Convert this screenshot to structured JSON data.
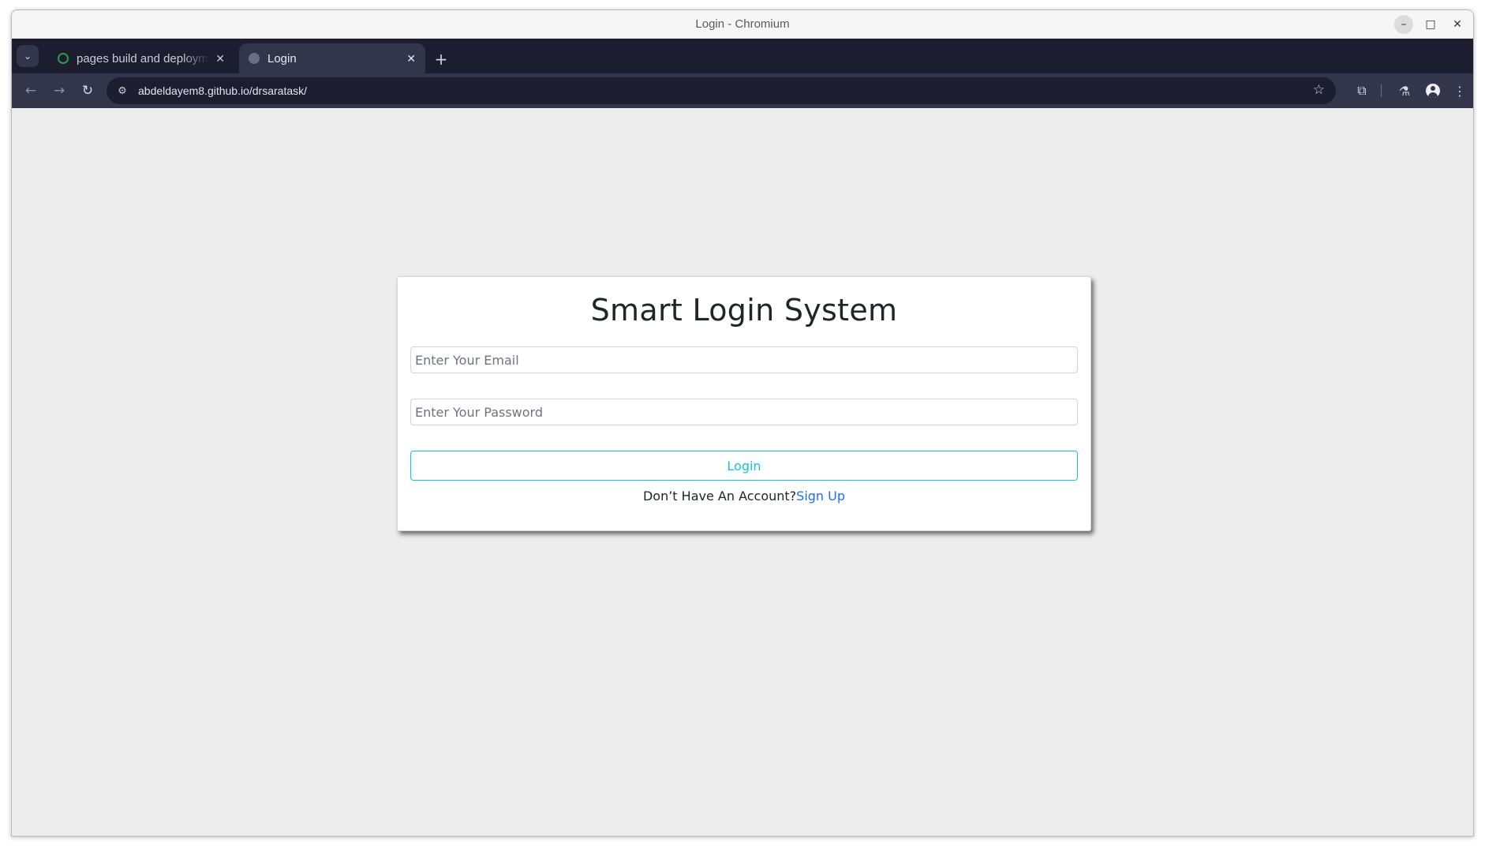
{
  "window": {
    "title": "Login - Chromium",
    "controls": {
      "minimize": "–",
      "maximize": "□",
      "close": "✕"
    }
  },
  "tabs": [
    {
      "label": "pages build and deployment",
      "close": "✕",
      "active": false
    },
    {
      "label": "Login",
      "close": "✕",
      "active": true
    }
  ],
  "tabbar": {
    "search_icon": "⌄",
    "new_tab": "+"
  },
  "toolbar": {
    "back": "←",
    "forward": "→",
    "reload": "↻",
    "site_info_icon": "⚙",
    "url": "abdeldayem8.github.io/drsaratask/",
    "bookmark_icon": "☆",
    "extensions_icon": "⧉",
    "labs_icon": "⚗",
    "menu_icon": "⋮"
  },
  "page": {
    "title": "Smart Login System",
    "email_placeholder": "Enter Your Email",
    "email_value": "",
    "password_placeholder": "Enter Your Password",
    "password_value": "",
    "login_label": "Login",
    "signup_prompt": "Don’t Have An Account?",
    "signup_link": "Sign Up"
  },
  "colors": {
    "tabbar_bg": "#1c1e2f",
    "toolbar_bg": "#33364a",
    "page_bg": "#ededed",
    "login_accent": "#17c1de",
    "link": "#1b6ff5"
  }
}
